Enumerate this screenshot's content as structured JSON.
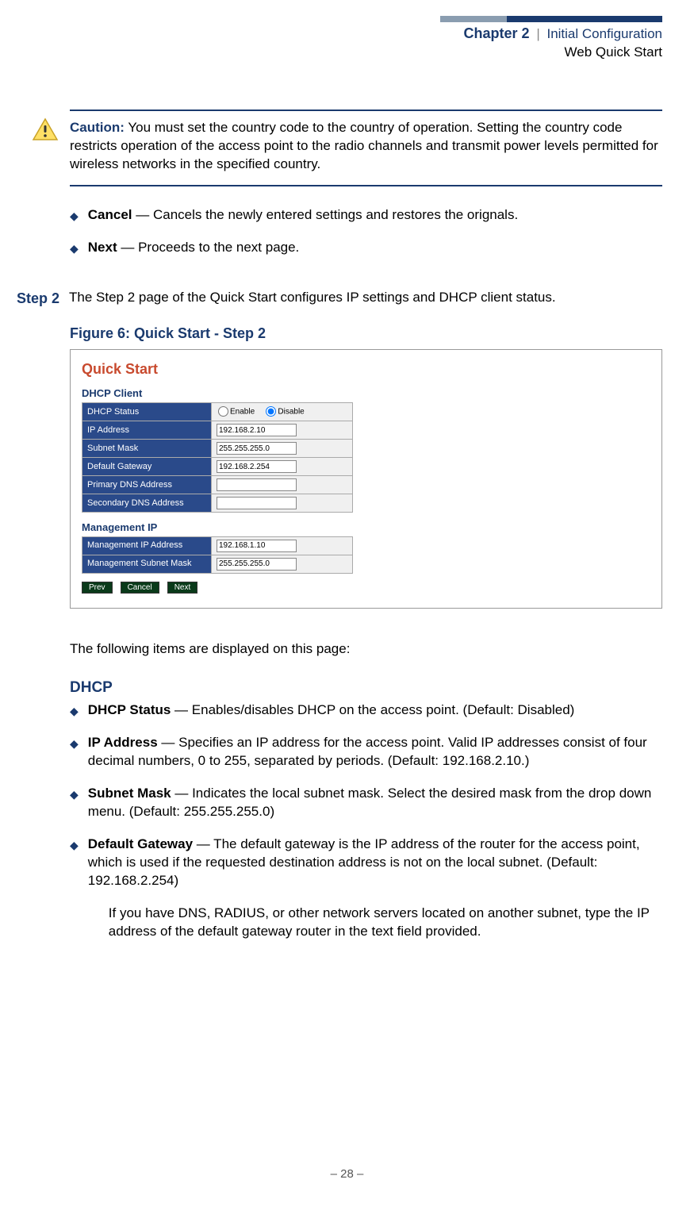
{
  "header": {
    "chapter_prefix": "Chapter 2",
    "chapter_name": "Initial Configuration",
    "subtitle": "Web Quick Start"
  },
  "caution": {
    "label": "Caution:",
    "text": " You must set the country code to the country of operation. Setting the country code restricts operation of the access point to the radio channels and transmit power levels permitted for wireless networks in the specified country."
  },
  "top_bullets": [
    {
      "bold": "Cancel",
      "rest": " — Cancels the newly entered settings and restores the orignals."
    },
    {
      "bold": "Next",
      "rest": " — Proceeds to the next page."
    }
  ],
  "step": {
    "label": "Step 2",
    "text": "The Step 2 page of the Quick Start configures IP settings and DHCP client status."
  },
  "figure": {
    "caption": "Figure 6:  Quick Start - Step 2",
    "title": "Quick Start",
    "dhcp_section": "DHCP Client",
    "mgmt_section": "Management IP",
    "rows_dhcp": [
      {
        "label": "DHCP Status",
        "type": "radio",
        "opts": [
          "Enable",
          "Disable"
        ],
        "sel": 1
      },
      {
        "label": "IP Address",
        "type": "text",
        "value": "192.168.2.10"
      },
      {
        "label": "Subnet Mask",
        "type": "text",
        "value": "255.255.255.0"
      },
      {
        "label": "Default Gateway",
        "type": "text",
        "value": "192.168.2.254"
      },
      {
        "label": "Primary DNS Address",
        "type": "text",
        "value": ""
      },
      {
        "label": "Secondary DNS Address",
        "type": "text",
        "value": ""
      }
    ],
    "rows_mgmt": [
      {
        "label": "Management IP Address",
        "type": "text",
        "value": "192.168.1.10"
      },
      {
        "label": "Management Subnet Mask",
        "type": "text",
        "value": "255.255.255.0"
      }
    ],
    "buttons": [
      "Prev",
      "Cancel",
      "Next"
    ]
  },
  "intro_line": "The following items are displayed on this page:",
  "dhcp_heading": "DHCP",
  "dhcp_bullets": [
    {
      "bold": "DHCP Status",
      "rest": " — Enables/disables DHCP on the access point. (Default: Disabled)"
    },
    {
      "bold": "IP Address",
      "rest": " — Specifies an IP address for the access point. Valid IP addresses consist of four decimal numbers, 0 to 255, separated by periods. (Default: 192.168.2.10.)"
    },
    {
      "bold": "Subnet Mask",
      "rest": " — Indicates the local subnet mask. Select the desired mask from the drop down menu. (Default: 255.255.255.0)"
    },
    {
      "bold": "Default Gateway",
      "rest": " — The default gateway is the IP address of the router for the access point, which is used if the requested destination address is not on the local subnet. (Default: 192.168.2.254)",
      "extra": "If you have DNS, RADIUS, or other network servers located on another subnet, type the IP address of the default gateway router in the text field provided."
    }
  ],
  "footer": "–  28  –"
}
